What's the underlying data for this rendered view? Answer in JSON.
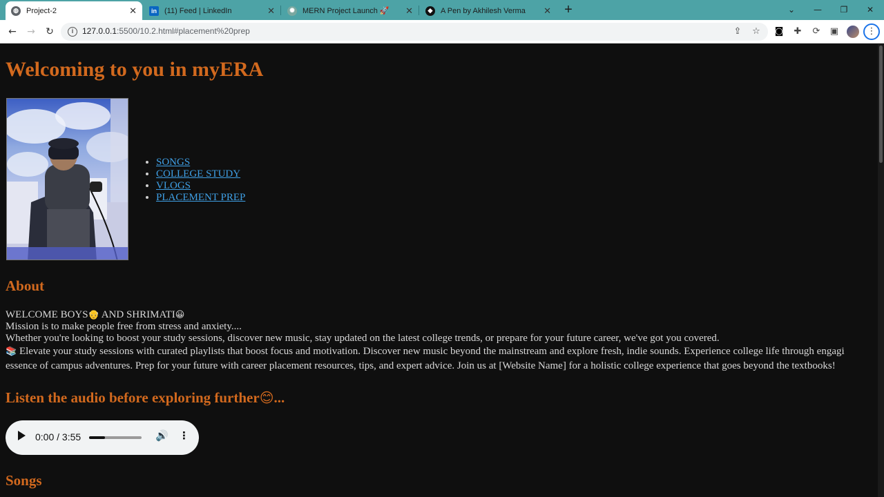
{
  "browser": {
    "tabs": [
      {
        "title": "Project-2",
        "favicon": "globe-icon",
        "active": true
      },
      {
        "title": "(11) Feed | LinkedIn",
        "favicon": "linkedin-icon",
        "active": false
      },
      {
        "title": "MERN Project Launch 🚀",
        "favicon": "chatgpt-icon",
        "active": false
      },
      {
        "title": "A Pen by Akhilesh Verma",
        "favicon": "codepen-icon",
        "active": false
      }
    ],
    "new_tab": "+",
    "url_host": "127.0.0.1",
    "url_path": ":5500/10.2.html#placement%20prep",
    "colors": {
      "tabbar": "#4da3a6",
      "accent": "#1a73e8"
    }
  },
  "page": {
    "title": "Welcoming to you in myERA",
    "nav": [
      "SONGS",
      "COLLEGE STUDY",
      "VLOGS",
      "PLACEMENT PREP"
    ],
    "about": {
      "heading": "About",
      "greeting_a": "WELCOME BOYS",
      "greeting_b": " AND SHRIMATI",
      "mission": "Mission is to make people free from stress and anxiety....",
      "intro": "Whether you're looking to boost your study sessions, discover new music, stay updated on the latest college trends, or prepare for your future career, we've got you covered.",
      "line1": " Elevate your study sessions with curated playlists that boost focus and motivation.  Discover new music beyond the mainstream and explore fresh, indie sounds.  Experience college life through engagi",
      "line2": "essence of campus adventures.  Prep for your future with career placement resources, tips, and expert advice.  Join us at [Website Name] for a holistic college experience that goes beyond the textbooks!"
    },
    "listen_heading": "Listen the audio before exploring further",
    "listen_suffix": "...",
    "audio": {
      "time": "0:00 / 3:55",
      "progress": 0.3
    },
    "songs_heading": "Songs",
    "colors": {
      "heading": "#d2691e",
      "link": "#3fa0e6",
      "background": "#0f0f0f",
      "text": "#d8d8d8"
    }
  }
}
